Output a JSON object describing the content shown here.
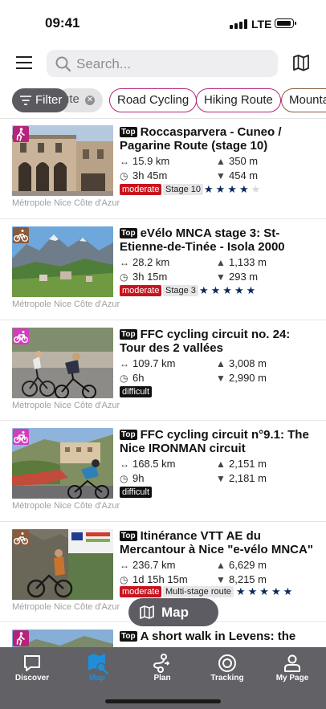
{
  "status_bar": {
    "time": "09:41",
    "network": "LTE"
  },
  "search": {
    "placeholder": "Search..."
  },
  "filter": {
    "label": "Filter"
  },
  "chips": [
    {
      "label": "ute"
    },
    {
      "label": "Road Cycling"
    },
    {
      "label": "Hiking Route"
    },
    {
      "label": "Mounta"
    }
  ],
  "routes": [
    {
      "top": "Top",
      "title": "Roccasparvera - Cuneo / Pagarine Route (stage 10)",
      "distance": "15.9 km",
      "duration": "3h 45m",
      "ascent": "350 m",
      "descent": "454 m",
      "difficulty": "moderate",
      "stage": "Stage 10",
      "rating": 4,
      "source": "Métropole Nice Côte d'Azur",
      "activity_icon": "hiking-icon",
      "icon_color": "#b5247a"
    },
    {
      "top": "Top",
      "title": "eVélo MNCA stage 3: St-Etienne-de-Tinée - Isola 2000",
      "distance": "28.2 km",
      "duration": "3h 15m",
      "ascent": "1,133 m",
      "descent": "293 m",
      "difficulty": "moderate",
      "stage": "Stage 3",
      "rating": 5,
      "source": "Métropole Nice Côte d'Azur",
      "activity_icon": "mountain-bike-icon",
      "icon_color": "#8a5a3a"
    },
    {
      "top": "Top",
      "title": "FFC cycling circuit no. 24: Tour des 2 vallées",
      "distance": "109.7 km",
      "duration": "6h",
      "ascent": "3,008 m",
      "descent": "2,990 m",
      "difficulty": "difficult",
      "source": "Métropole Nice Côte d'Azur",
      "activity_icon": "road-bike-icon",
      "icon_color": "#d43cc0"
    },
    {
      "top": "Top",
      "title": "FFC cycling circuit n°9.1: The Nice IRONMAN circuit",
      "distance": "168.5 km",
      "duration": "9h",
      "ascent": "2,151 m",
      "descent": "2,181 m",
      "difficulty": "difficult",
      "source": "Métropole Nice Côte d'Azur",
      "activity_icon": "road-bike-icon",
      "icon_color": "#d43cc0"
    },
    {
      "top": "Top",
      "title": "Itinérance VTT AE du Mercantour à Nice \"e-vélo MNCA\"",
      "distance": "236.7 km",
      "duration": "1d 15h 15m",
      "ascent": "6,629 m",
      "descent": "8,215 m",
      "difficulty": "moderate",
      "stage": "Multi-stage route",
      "rating": 5,
      "source": "Métropole Nice Côte d'Azur",
      "activity_icon": "mountain-bike-icon",
      "icon_color": "#8a5a3a"
    },
    {
      "top": "Top",
      "title": "A short walk in Levens: the",
      "activity_icon": "hiking-icon",
      "icon_color": "#b5247a"
    }
  ],
  "float_map": {
    "label": "Map"
  },
  "tabs": [
    {
      "label": "Discover",
      "icon": "chat-bubble-icon"
    },
    {
      "label": "Map",
      "icon": "map-search-icon",
      "active": true
    },
    {
      "label": "Plan",
      "icon": "route-plan-icon"
    },
    {
      "label": "Tracking",
      "icon": "tracking-icon"
    },
    {
      "label": "My Page",
      "icon": "person-icon"
    }
  ],
  "colors": {
    "accent": "#b5247a",
    "moderate": "#c8141e",
    "active_tab": "#1f8ed8",
    "tabbar": "#616166"
  }
}
